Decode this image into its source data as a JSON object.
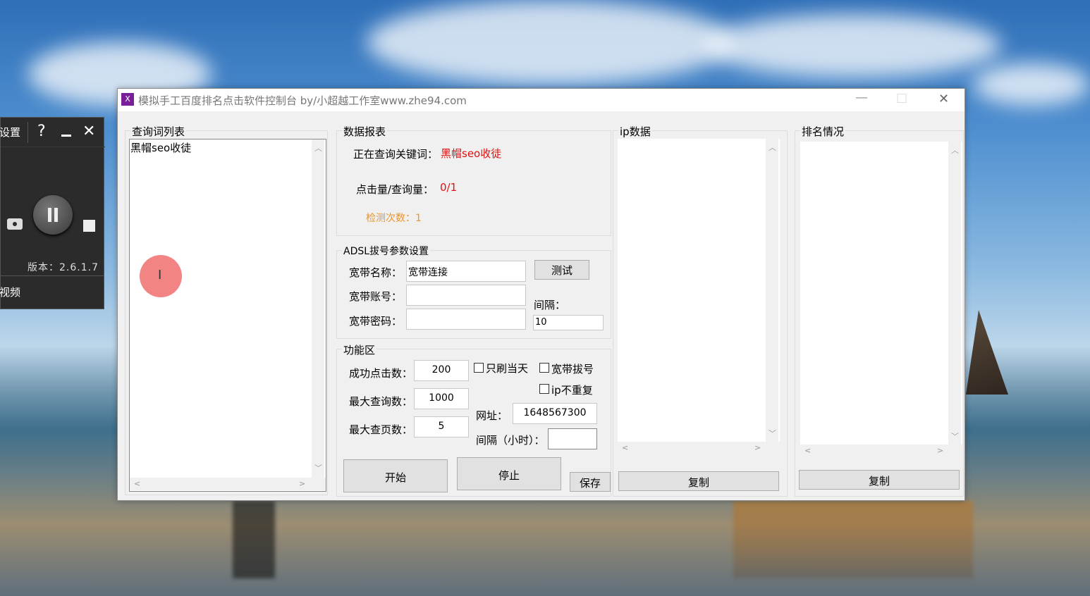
{
  "recorder": {
    "settings_label": "设置",
    "help_glyph": "?",
    "close_glyph": "✕",
    "version_text": "版本：2.6.1.7",
    "video_label": "视频"
  },
  "cursor": {
    "glyph": "I"
  },
  "window": {
    "icon_letter": "X",
    "title": "模拟手工百度排名点击软件控制台 by/小超越工作室www.zhe94.com",
    "minimize_glyph": "—",
    "maximize_glyph": "☐",
    "close_glyph": "✕"
  },
  "keyword_list": {
    "label": "查询词列表",
    "items": [
      "黑帽seo收徒"
    ]
  },
  "report": {
    "label": "数据报表",
    "query_keyword_label": "正在查询关键词：",
    "query_keyword_value": "黑帽seo收徒",
    "click_query_label": "点击量/查询量：",
    "click_query_value": "0/1",
    "detect_count_text": "检测次数：1"
  },
  "adsl": {
    "label": "ADSL拔号参数设置",
    "name_label": "宽带名称：",
    "name_value": "宽带连接",
    "account_label": "宽带账号：",
    "account_value": "",
    "password_label": "宽带密码：",
    "password_value": "",
    "test_button": "测试",
    "interval_label": "间隔：",
    "interval_value": "10"
  },
  "functions": {
    "label": "功能区",
    "success_clicks_label": "成功点击数：",
    "success_clicks_value": "200",
    "max_queries_label": "最大查询数：",
    "max_queries_value": "1000",
    "max_pages_label": "最大查页数：",
    "max_pages_value": "5",
    "only_today_label": "只刷当天",
    "broadband_dial_label": "宽带拔号",
    "ip_no_repeat_label": "ip不重复",
    "url_label": "网址：",
    "url_value": "1648567300",
    "interval_hours_label": "间隔（小时）：",
    "interval_hours_value": ""
  },
  "buttons": {
    "start": "开始",
    "stop": "停止",
    "save": "保存"
  },
  "ip_data": {
    "label": "ip数据",
    "copy_button": "复制"
  },
  "ranking": {
    "label": "排名情况",
    "copy_button": "复制"
  }
}
